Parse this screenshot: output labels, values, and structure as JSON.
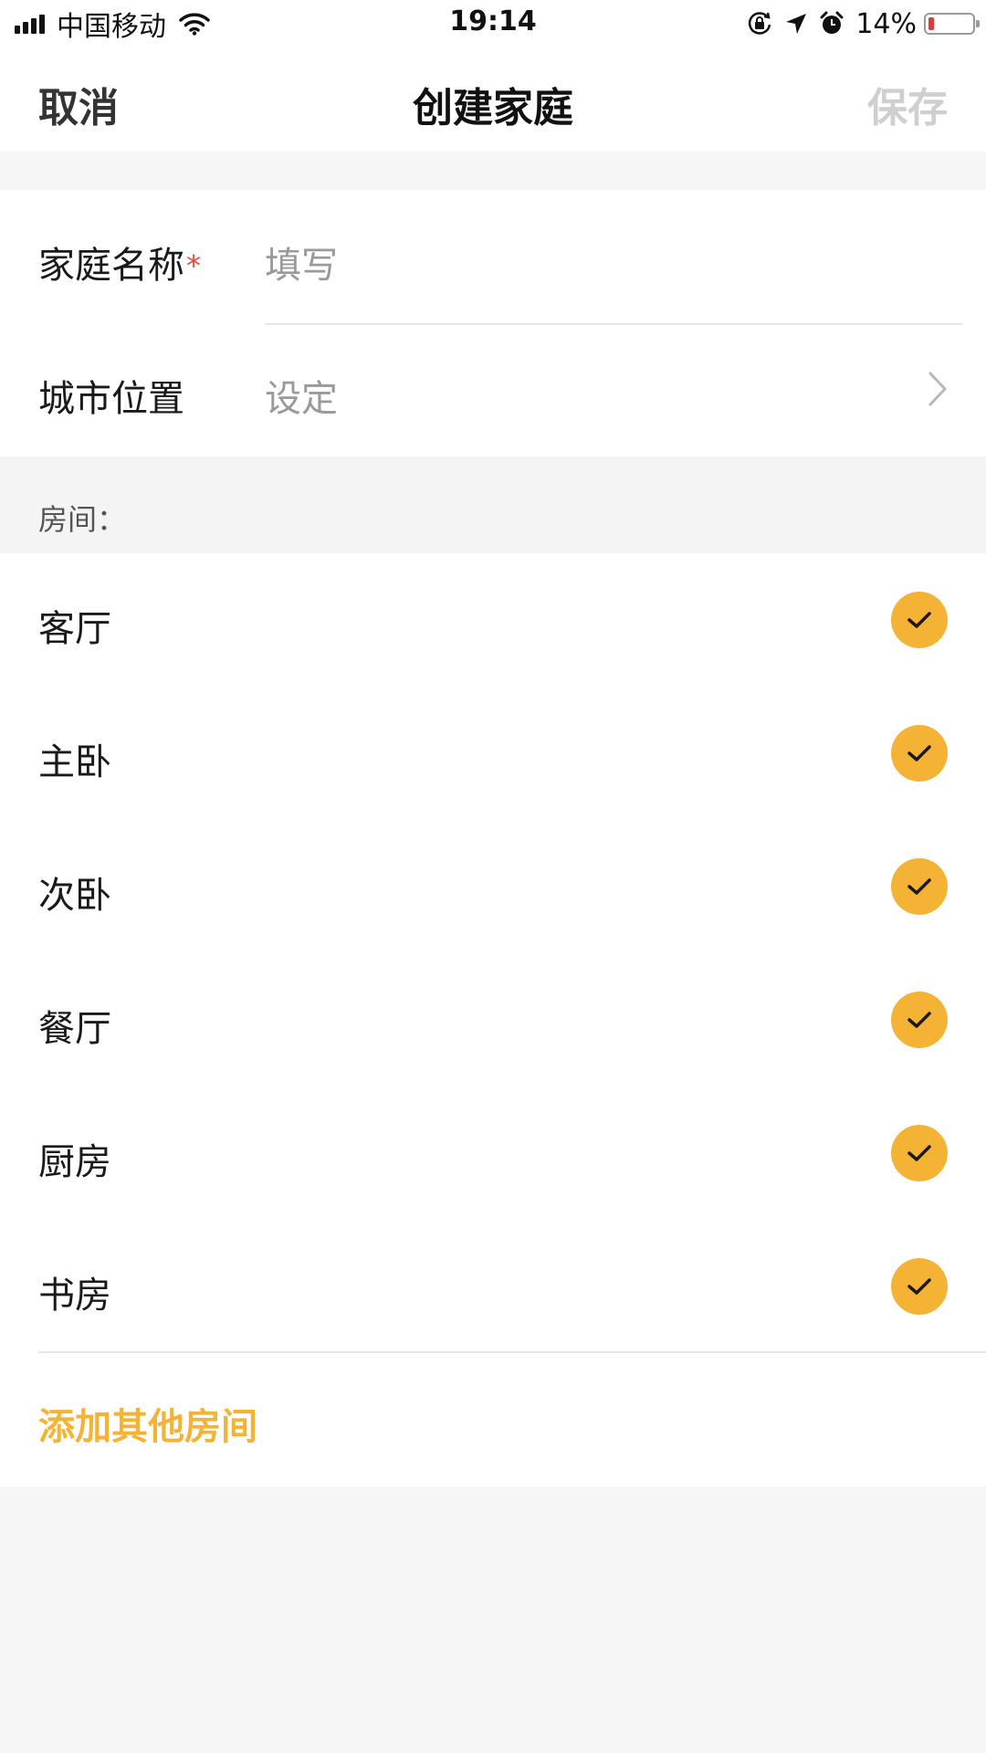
{
  "status_bar": {
    "carrier": "中国移动",
    "time": "19:14",
    "battery_percent": "14%",
    "battery_level": 0.14,
    "icons": [
      "signal-icon",
      "wifi-icon",
      "rotation-lock-icon",
      "location-icon",
      "alarm-icon",
      "battery-icon"
    ]
  },
  "nav": {
    "cancel_label": "取消",
    "title": "创建家庭",
    "save_label": "保存"
  },
  "form": {
    "home_name_label": "家庭名称",
    "required_mark": "*",
    "home_name_placeholder": "填写",
    "city_label": "城市位置",
    "city_value": "设定"
  },
  "rooms": {
    "header": "房间：",
    "items": [
      {
        "label": "客厅",
        "checked": true
      },
      {
        "label": "主卧",
        "checked": true
      },
      {
        "label": "次卧",
        "checked": true
      },
      {
        "label": "餐厅",
        "checked": true
      },
      {
        "label": "厨房",
        "checked": true
      },
      {
        "label": "书房",
        "checked": true
      }
    ],
    "add_label": "添加其他房间"
  },
  "colors": {
    "accent": "#f5b335",
    "required": "#e24c3b",
    "disabled_text": "#cfcfcf",
    "placeholder_text": "#9a9a9a",
    "background": "#f6f6f6"
  }
}
